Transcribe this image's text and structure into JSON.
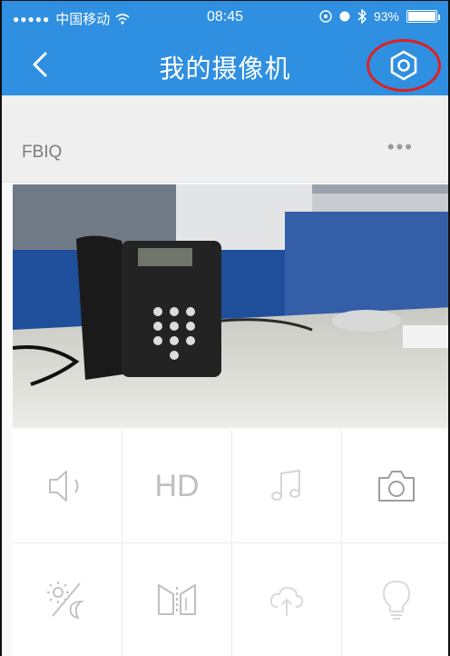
{
  "status_bar": {
    "signal_dots": "●●●●●",
    "carrier": "中国移动",
    "time": "08:45",
    "battery_percent": "93%",
    "battery_level": 0.93
  },
  "nav": {
    "title": "我的摄像机"
  },
  "device": {
    "name": "FBIQ",
    "more_label": "•••"
  },
  "controls": {
    "hd_label": "HD",
    "icons": [
      "speaker-icon",
      "hd-icon",
      "music-icon",
      "camera-icon",
      "day-night-icon",
      "mirror-icon",
      "cloud-upload-icon",
      "lightbulb-icon"
    ]
  },
  "colors": {
    "header_blue": "#2f8fe0",
    "highlight_ring": "#e02020",
    "icon_gray": "#bfbfbf"
  }
}
